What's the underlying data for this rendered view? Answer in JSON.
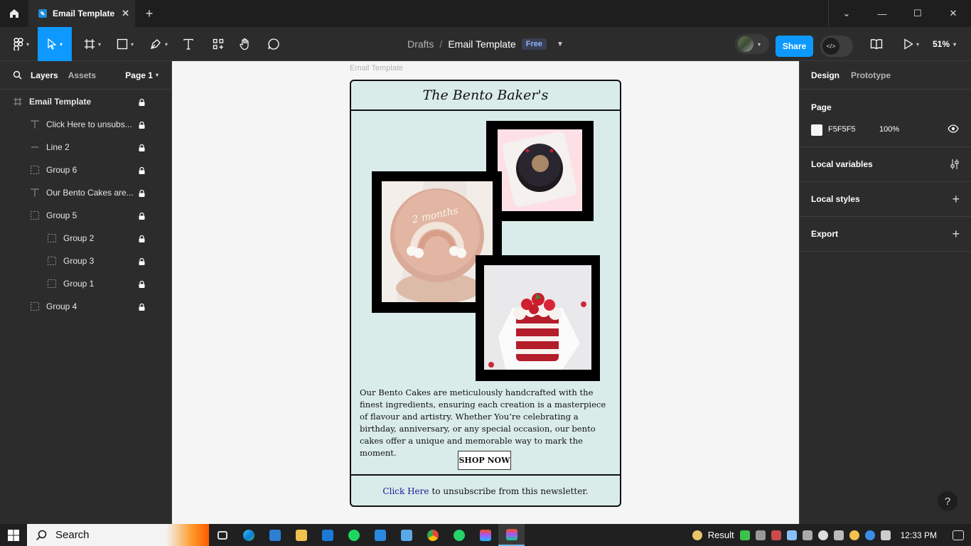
{
  "window": {
    "tab_title": "Email Template",
    "colors": {
      "accent": "#0d99ff",
      "canvas_bg": "#f5f5f5",
      "email_bg": "#d9ece9"
    }
  },
  "toolbar": {
    "breadcrumb_project": "Drafts",
    "breadcrumb_separator": "/",
    "file_name": "Email Template",
    "plan_badge": "Free",
    "share_label": "Share",
    "zoom_label": "51%"
  },
  "left_panel": {
    "tab_layers": "Layers",
    "tab_assets": "Assets",
    "page_selector": "Page 1",
    "layers": [
      {
        "label": "Email Template",
        "icon": "frame-icon"
      },
      {
        "label": "Click Here to unsubs...",
        "icon": "text-icon"
      },
      {
        "label": "Line 2",
        "icon": "line-icon"
      },
      {
        "label": "Group 6",
        "icon": "group-icon"
      },
      {
        "label": "Our Bento Cakes are...",
        "icon": "text-icon"
      },
      {
        "label": "Group 5",
        "icon": "group-icon"
      },
      {
        "label": "Group 2",
        "icon": "group-icon"
      },
      {
        "label": "Group 3",
        "icon": "group-icon"
      },
      {
        "label": "Group 1",
        "icon": "group-icon"
      },
      {
        "label": "Group 4",
        "icon": "group-icon"
      }
    ]
  },
  "right_panel": {
    "tab_design": "Design",
    "tab_prototype": "Prototype",
    "page_section_title": "Page",
    "page_color_hex": "F5F5F5",
    "page_opacity": "100%",
    "local_variables": "Local variables",
    "local_styles": "Local styles",
    "export": "Export"
  },
  "canvas": {
    "frame_label": "Email Template",
    "email": {
      "header_title": "The Bento Baker's",
      "body_text": "Our Bento Cakes are meticulously handcrafted with the finest ingredients, ensuring each creation is a masterpiece of flavour and artistry. Whether You’re celebrating a birthday, anniversary, or any special occasion, our bento cakes offer a unique and memorable way to mark the moment.",
      "cta_label": "SHOP NOW",
      "footer_link": "Click Here",
      "footer_text": "to unsubscribe from this newsletter.",
      "cake1_text": "2 months"
    }
  },
  "help_label": "?",
  "taskbar": {
    "search_placeholder": "Search",
    "tray_weather": "Result",
    "clock": "12:33 PM"
  }
}
